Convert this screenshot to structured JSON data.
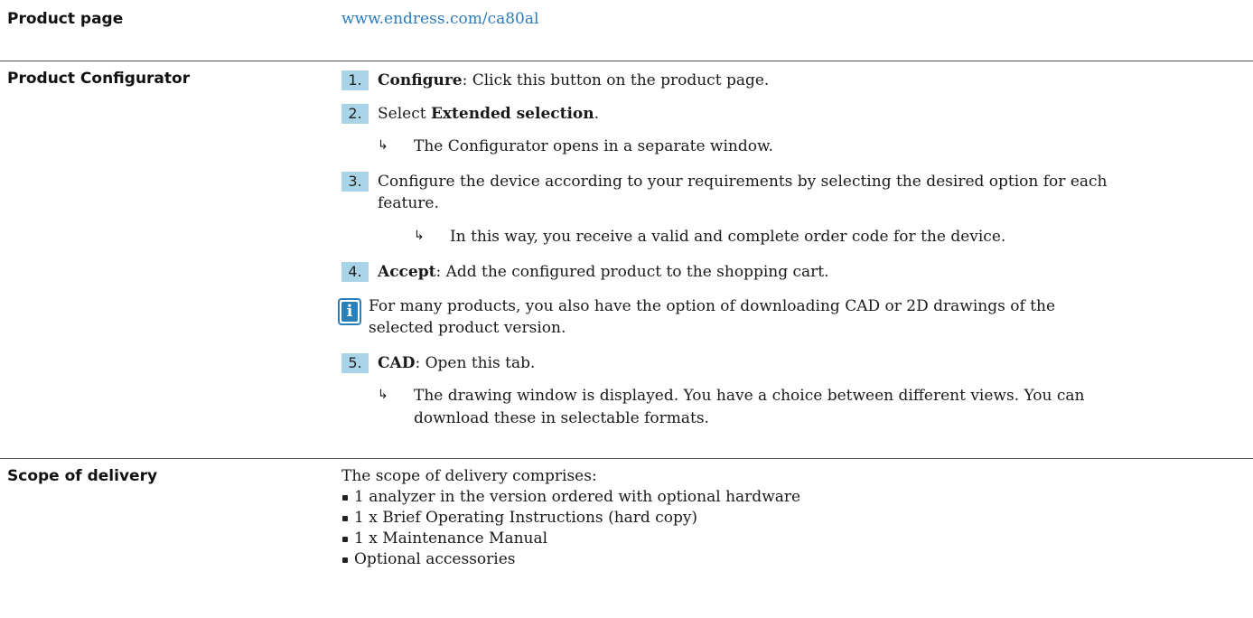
{
  "product_page": {
    "label": "Product page",
    "link": "www.endress.com/ca80al"
  },
  "product_configurator": {
    "label": "Product Configurator",
    "steps": [
      {
        "num": "1.",
        "bold": "Configure",
        "rest": ": Click this button on the product page."
      },
      {
        "num": "2.",
        "pre": "Select ",
        "bold": "Extended selection",
        "rest": "."
      },
      {
        "num": "3.",
        "rest_line1": "Configure the device according to your requirements by selecting the desired option for each",
        "rest_line2": "feature."
      },
      {
        "num": "4.",
        "bold": "Accept",
        "rest": ": Add the configured product to the shopping cart."
      },
      {
        "num": "5.",
        "bold": "CAD",
        "rest": ": Open this tab."
      }
    ],
    "results": {
      "step2": "The Configurator opens in a separate window.",
      "step3": "In this way, you receive a valid and complete order code for the device.",
      "step5_line1": "The drawing window is displayed. You have a choice between different views. You can",
      "step5_line2": "download these in selectable formats."
    },
    "info_note_line1": "For many products, you also have the option of downloading CAD or 2D drawings of the",
    "info_note_line2": "selected product version.",
    "info_icon_letter": "i"
  },
  "scope_of_delivery": {
    "label": "Scope of delivery",
    "intro": "The scope of delivery comprises:",
    "items": [
      "1 analyzer in the version ordered with optional hardware",
      "1 x Brief Operating Instructions (hard copy)",
      "1 x Maintenance Manual",
      "Optional accessories"
    ]
  }
}
